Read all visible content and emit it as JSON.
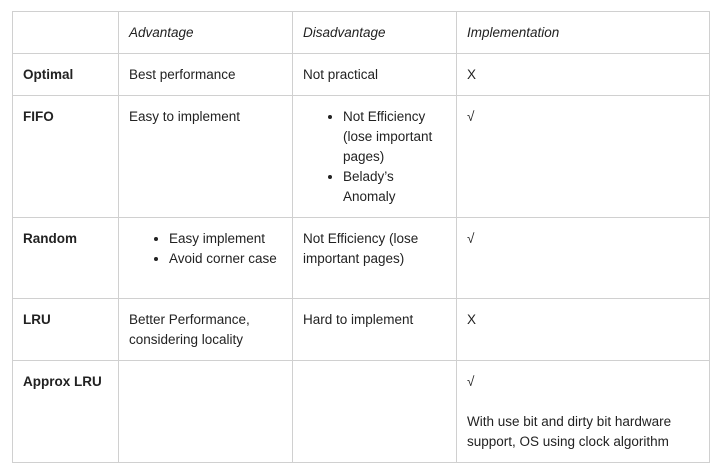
{
  "table": {
    "headers": [
      "",
      "Advantage",
      "Disadvantage",
      "Implementation"
    ],
    "rows": [
      {
        "name": "Optimal",
        "advantage": "Best performance",
        "disadvantage": "Not practical",
        "implementation": "X"
      },
      {
        "name": "FIFO",
        "advantage": "Easy to implement",
        "disadvantage_items": [
          "Not Efficiency (lose important pages)",
          "Belady’s Anomaly"
        ],
        "implementation": "√"
      },
      {
        "name": "Random",
        "advantage_items": [
          "Easy implement",
          "Avoid corner case"
        ],
        "disadvantage": "Not Efficiency (lose important pages)",
        "implementation": "√"
      },
      {
        "name": "LRU",
        "advantage": "Better Performance, considering locality",
        "disadvantage": "Hard to implement",
        "implementation": "X"
      },
      {
        "name": "Approx LRU",
        "advantage": "",
        "disadvantage": "",
        "implementation": "√",
        "implementation_note": "With use bit and dirty bit hardware support, OS using clock algorithm"
      }
    ]
  }
}
